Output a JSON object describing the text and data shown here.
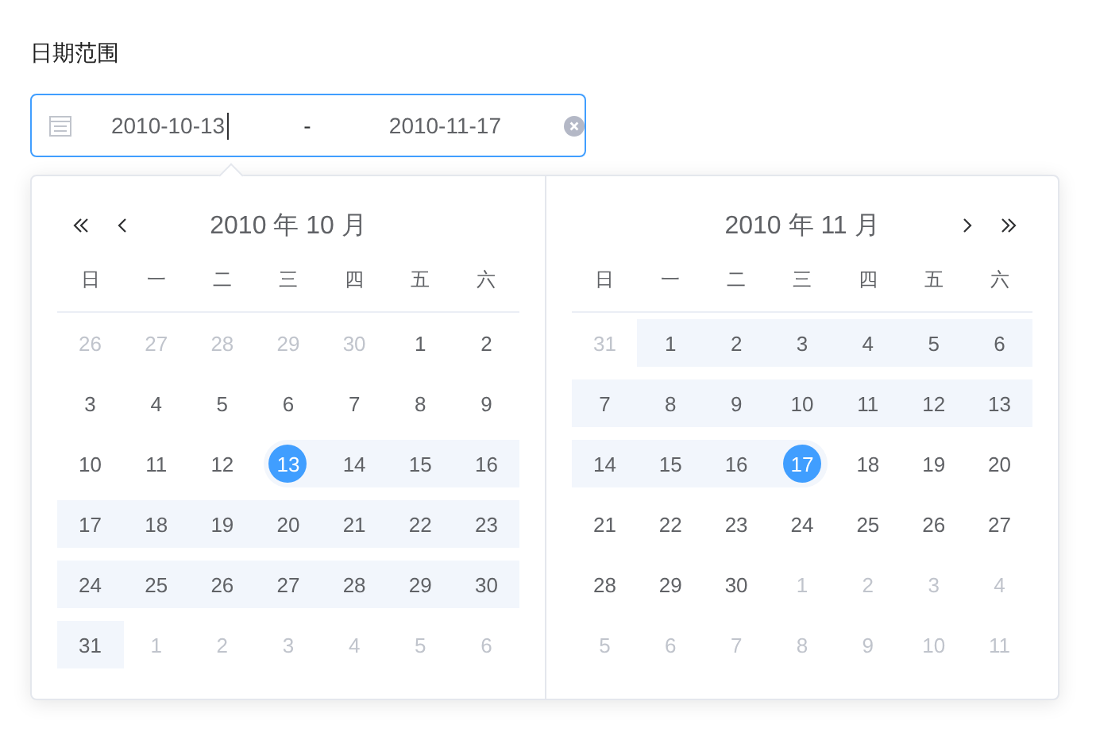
{
  "label": "日期范围",
  "input": {
    "start": "2010-10-13",
    "separator": "-",
    "end": "2010-11-17"
  },
  "panels": [
    {
      "title": "2010 年 10 月",
      "weekdays": [
        "日",
        "一",
        "二",
        "三",
        "四",
        "五",
        "六"
      ],
      "days": [
        {
          "day": "26",
          "other_month": true,
          "in_range": false,
          "selected": false
        },
        {
          "day": "27",
          "other_month": true,
          "in_range": false,
          "selected": false
        },
        {
          "day": "28",
          "other_month": true,
          "in_range": false,
          "selected": false
        },
        {
          "day": "29",
          "other_month": true,
          "in_range": false,
          "selected": false
        },
        {
          "day": "30",
          "other_month": true,
          "in_range": false,
          "selected": false
        },
        {
          "day": "1",
          "other_month": false,
          "in_range": false,
          "selected": false
        },
        {
          "day": "2",
          "other_month": false,
          "in_range": false,
          "selected": false
        },
        {
          "day": "3",
          "other_month": false,
          "in_range": false,
          "selected": false
        },
        {
          "day": "4",
          "other_month": false,
          "in_range": false,
          "selected": false
        },
        {
          "day": "5",
          "other_month": false,
          "in_range": false,
          "selected": false
        },
        {
          "day": "6",
          "other_month": false,
          "in_range": false,
          "selected": false
        },
        {
          "day": "7",
          "other_month": false,
          "in_range": false,
          "selected": false
        },
        {
          "day": "8",
          "other_month": false,
          "in_range": false,
          "selected": false
        },
        {
          "day": "9",
          "other_month": false,
          "in_range": false,
          "selected": false
        },
        {
          "day": "10",
          "other_month": false,
          "in_range": false,
          "selected": false
        },
        {
          "day": "11",
          "other_month": false,
          "in_range": false,
          "selected": false
        },
        {
          "day": "12",
          "other_month": false,
          "in_range": false,
          "selected": false
        },
        {
          "day": "13",
          "other_month": false,
          "in_range": true,
          "selected": true
        },
        {
          "day": "14",
          "other_month": false,
          "in_range": true,
          "selected": false
        },
        {
          "day": "15",
          "other_month": false,
          "in_range": true,
          "selected": false
        },
        {
          "day": "16",
          "other_month": false,
          "in_range": true,
          "selected": false
        },
        {
          "day": "17",
          "other_month": false,
          "in_range": true,
          "selected": false
        },
        {
          "day": "18",
          "other_month": false,
          "in_range": true,
          "selected": false
        },
        {
          "day": "19",
          "other_month": false,
          "in_range": true,
          "selected": false
        },
        {
          "day": "20",
          "other_month": false,
          "in_range": true,
          "selected": false
        },
        {
          "day": "21",
          "other_month": false,
          "in_range": true,
          "selected": false
        },
        {
          "day": "22",
          "other_month": false,
          "in_range": true,
          "selected": false
        },
        {
          "day": "23",
          "other_month": false,
          "in_range": true,
          "selected": false
        },
        {
          "day": "24",
          "other_month": false,
          "in_range": true,
          "selected": false
        },
        {
          "day": "25",
          "other_month": false,
          "in_range": true,
          "selected": false
        },
        {
          "day": "26",
          "other_month": false,
          "in_range": true,
          "selected": false
        },
        {
          "day": "27",
          "other_month": false,
          "in_range": true,
          "selected": false
        },
        {
          "day": "28",
          "other_month": false,
          "in_range": true,
          "selected": false
        },
        {
          "day": "29",
          "other_month": false,
          "in_range": true,
          "selected": false
        },
        {
          "day": "30",
          "other_month": false,
          "in_range": true,
          "selected": false
        },
        {
          "day": "31",
          "other_month": false,
          "in_range": true,
          "selected": false
        },
        {
          "day": "1",
          "other_month": true,
          "in_range": false,
          "selected": false
        },
        {
          "day": "2",
          "other_month": true,
          "in_range": false,
          "selected": false
        },
        {
          "day": "3",
          "other_month": true,
          "in_range": false,
          "selected": false
        },
        {
          "day": "4",
          "other_month": true,
          "in_range": false,
          "selected": false
        },
        {
          "day": "5",
          "other_month": true,
          "in_range": false,
          "selected": false
        },
        {
          "day": "6",
          "other_month": true,
          "in_range": false,
          "selected": false
        }
      ]
    },
    {
      "title": "2010 年 11 月",
      "weekdays": [
        "日",
        "一",
        "二",
        "三",
        "四",
        "五",
        "六"
      ],
      "days": [
        {
          "day": "31",
          "other_month": true,
          "in_range": false,
          "selected": false
        },
        {
          "day": "1",
          "other_month": false,
          "in_range": true,
          "selected": false
        },
        {
          "day": "2",
          "other_month": false,
          "in_range": true,
          "selected": false
        },
        {
          "day": "3",
          "other_month": false,
          "in_range": true,
          "selected": false
        },
        {
          "day": "4",
          "other_month": false,
          "in_range": true,
          "selected": false
        },
        {
          "day": "5",
          "other_month": false,
          "in_range": true,
          "selected": false
        },
        {
          "day": "6",
          "other_month": false,
          "in_range": true,
          "selected": false
        },
        {
          "day": "7",
          "other_month": false,
          "in_range": true,
          "selected": false
        },
        {
          "day": "8",
          "other_month": false,
          "in_range": true,
          "selected": false
        },
        {
          "day": "9",
          "other_month": false,
          "in_range": true,
          "selected": false
        },
        {
          "day": "10",
          "other_month": false,
          "in_range": true,
          "selected": false
        },
        {
          "day": "11",
          "other_month": false,
          "in_range": true,
          "selected": false
        },
        {
          "day": "12",
          "other_month": false,
          "in_range": true,
          "selected": false
        },
        {
          "day": "13",
          "other_month": false,
          "in_range": true,
          "selected": false
        },
        {
          "day": "14",
          "other_month": false,
          "in_range": true,
          "selected": false
        },
        {
          "day": "15",
          "other_month": false,
          "in_range": true,
          "selected": false
        },
        {
          "day": "16",
          "other_month": false,
          "in_range": true,
          "selected": false
        },
        {
          "day": "17",
          "other_month": false,
          "in_range": true,
          "selected": true
        },
        {
          "day": "18",
          "other_month": false,
          "in_range": false,
          "selected": false
        },
        {
          "day": "19",
          "other_month": false,
          "in_range": false,
          "selected": false
        },
        {
          "day": "20",
          "other_month": false,
          "in_range": false,
          "selected": false
        },
        {
          "day": "21",
          "other_month": false,
          "in_range": false,
          "selected": false
        },
        {
          "day": "22",
          "other_month": false,
          "in_range": false,
          "selected": false
        },
        {
          "day": "23",
          "other_month": false,
          "in_range": false,
          "selected": false
        },
        {
          "day": "24",
          "other_month": false,
          "in_range": false,
          "selected": false
        },
        {
          "day": "25",
          "other_month": false,
          "in_range": false,
          "selected": false
        },
        {
          "day": "26",
          "other_month": false,
          "in_range": false,
          "selected": false
        },
        {
          "day": "27",
          "other_month": false,
          "in_range": false,
          "selected": false
        },
        {
          "day": "28",
          "other_month": false,
          "in_range": false,
          "selected": false
        },
        {
          "day": "29",
          "other_month": false,
          "in_range": false,
          "selected": false
        },
        {
          "day": "30",
          "other_month": false,
          "in_range": false,
          "selected": false
        },
        {
          "day": "1",
          "other_month": true,
          "in_range": false,
          "selected": false
        },
        {
          "day": "2",
          "other_month": true,
          "in_range": false,
          "selected": false
        },
        {
          "day": "3",
          "other_month": true,
          "in_range": false,
          "selected": false
        },
        {
          "day": "4",
          "other_month": true,
          "in_range": false,
          "selected": false
        },
        {
          "day": "5",
          "other_month": true,
          "in_range": false,
          "selected": false
        },
        {
          "day": "6",
          "other_month": true,
          "in_range": false,
          "selected": false
        },
        {
          "day": "7",
          "other_month": true,
          "in_range": false,
          "selected": false
        },
        {
          "day": "8",
          "other_month": true,
          "in_range": false,
          "selected": false
        },
        {
          "day": "9",
          "other_month": true,
          "in_range": false,
          "selected": false
        },
        {
          "day": "10",
          "other_month": true,
          "in_range": false,
          "selected": false
        },
        {
          "day": "11",
          "other_month": true,
          "in_range": false,
          "selected": false
        }
      ]
    }
  ]
}
